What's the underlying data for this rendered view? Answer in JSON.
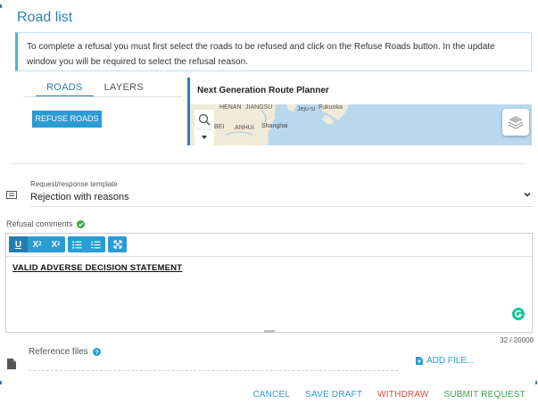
{
  "page": {
    "title": "Road list"
  },
  "info": {
    "text": "To complete a refusal you must first select the roads to be refused and click on the Refuse Roads button. In the update window you will be required to select the refusal reason."
  },
  "tabs": [
    {
      "label": "ROADS",
      "active": true
    },
    {
      "label": "LAYERS",
      "active": false
    }
  ],
  "refuse_button": {
    "label": "REFUSE ROADS"
  },
  "map": {
    "title": "Next Generation Route Planner",
    "labels": {
      "henan": "HENAN",
      "jiangsu": "JIANGSU",
      "jeju": "Jeju-si",
      "fukuoka": "Fukuoka",
      "bei": "BEI",
      "anhui": "ANHUI",
      "shanghai": "Shanghai"
    }
  },
  "template": {
    "label": "Request/response template",
    "value": "Rejection with reasons"
  },
  "comments": {
    "label": "Refusal comments",
    "toolbar": [
      {
        "name": "underline",
        "glyph": "U"
      },
      {
        "name": "superscript",
        "glyph": "X"
      },
      {
        "name": "subscript",
        "glyph": "X"
      },
      {
        "name": "bulleted-list",
        "glyph": ""
      },
      {
        "name": "numbered-list",
        "glyph": ""
      },
      {
        "name": "fullscreen",
        "glyph": ""
      }
    ],
    "content": "VALID ADVERSE DECISION STATEMENT",
    "char_count": "32 / 20000"
  },
  "reference_files": {
    "label": "Reference files",
    "add_label": "ADD FILE..."
  },
  "actions": {
    "cancel": "CANCEL",
    "save_draft": "SAVE DRAFT",
    "withdraw": "WITHDRAW",
    "submit": "SUBMIT REQUEST"
  },
  "colors": {
    "accent": "#2a9bd3",
    "title": "#2b7fb8",
    "withdraw": "#e04848",
    "submit": "#3aa855",
    "map_water": "#b9d8ee",
    "map_land": "#f0ead9"
  }
}
